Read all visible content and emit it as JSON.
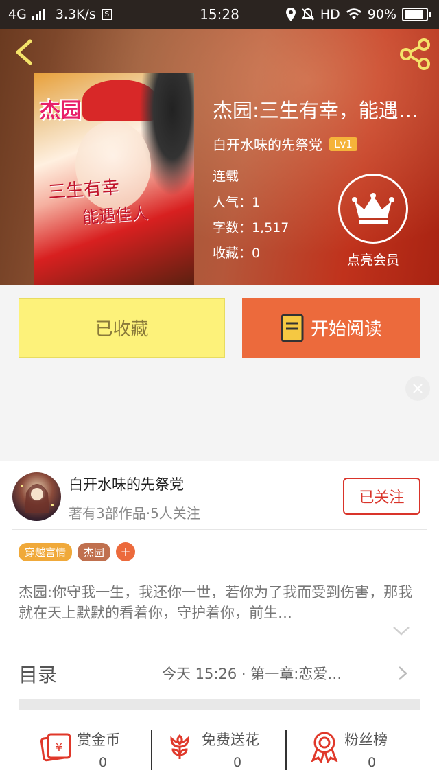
{
  "status_bar": {
    "network": "4G",
    "speed": "3.3K/s",
    "s_icon": "S",
    "time": "15:28",
    "hd": "HD",
    "battery": "90%"
  },
  "book": {
    "title": "杰园:三生有幸，能遇…",
    "author": "白开水味的先祭党",
    "level": "Lv1",
    "status": "连载",
    "popularity": "人气：1",
    "word_count": "字数：1,517",
    "favorites": "收藏：0",
    "cover_text": {
      "line1": "杰园",
      "line2": "三生有幸",
      "line3": "能遇佳人"
    }
  },
  "vip": {
    "label": "点亮会员"
  },
  "actions": {
    "collected_label": "已收藏",
    "read_label": "开始阅读"
  },
  "author_card": {
    "name": "白开水味的先祭党",
    "subtitle": "著有3部作品·5人关注",
    "follow_label": "已关注"
  },
  "tags": [
    {
      "label": "穿越言情",
      "color": "#f0a93a"
    },
    {
      "label": "杰园",
      "color": "#c0704e"
    }
  ],
  "tag_add": "+",
  "description": "杰园:你守我一生，我还你一世，若你为了我而受到伤害，那我就在天上默默的看着你，守护着你，前生…",
  "toc": {
    "label": "目录",
    "latest": "今天 15:26 · 第一章:恋爱…"
  },
  "bottom_bar": [
    {
      "label": "赏金币",
      "count": "0",
      "icon": "red-envelope-icon"
    },
    {
      "label": "免费送花",
      "count": "0",
      "icon": "flower-icon"
    },
    {
      "label": "粉丝榜",
      "count": "0",
      "icon": "medal-icon"
    }
  ],
  "colors": {
    "accent": "#ec6a3c",
    "collected_bg": "#fdf27a",
    "follow": "#d9342a",
    "level_badge": "#f5b33a"
  }
}
